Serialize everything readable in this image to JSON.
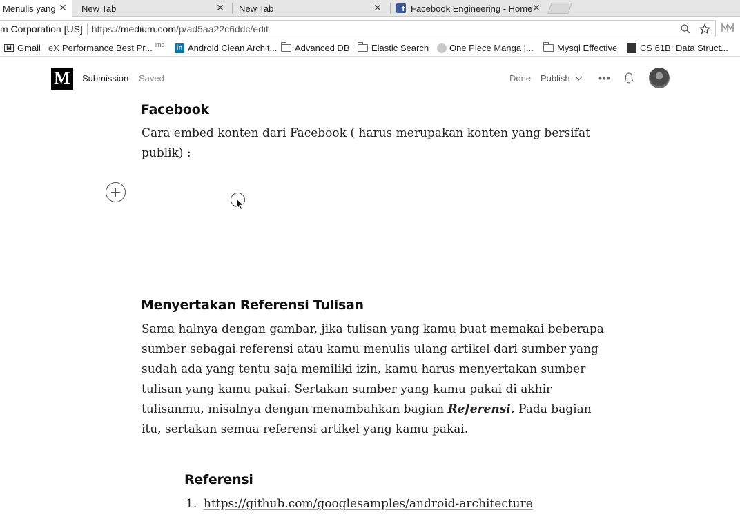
{
  "browser": {
    "tabs": [
      {
        "label": "Menulis yang"
      },
      {
        "label": "New Tab"
      },
      {
        "label": "New Tab"
      },
      {
        "label": "Facebook Engineering - Home"
      }
    ],
    "close_glyph": "✕",
    "address": {
      "org": "m Corporation [US]",
      "url_prefix": "https://",
      "url_host": "medium.com",
      "url_path": "/p/ad5aa22c6ddc/edit"
    },
    "bookmarks": [
      {
        "label": "Gmail",
        "icon": "gmail-icon"
      },
      {
        "label": "Performance Best Pr...",
        "icon": "ex-icon",
        "icon_text": "eX"
      },
      {
        "label": "",
        "icon": "imgur-icon",
        "icon_text": "img"
      },
      {
        "label": "Android Clean Archit...",
        "icon": "linkedin-icon",
        "icon_text": "in"
      },
      {
        "label": "Advanced DB",
        "icon": "folder-icon"
      },
      {
        "label": "Elastic Search",
        "icon": "folder-icon"
      },
      {
        "label": "One Piece Manga |...",
        "icon": "manga-icon"
      },
      {
        "label": "Mysql Effective",
        "icon": "folder-icon"
      },
      {
        "label": "CS 61B: Data Struct...",
        "icon": "cs61b-icon"
      }
    ]
  },
  "medium": {
    "logo": "M",
    "section": "Submission",
    "status": "Saved",
    "done_label": "Done",
    "publish_label": "Publish",
    "more_glyph": "•••"
  },
  "article": {
    "fb_heading": "Facebook",
    "fb_line1": "Cara embed konten dari Facebook ( harus merupakan konten yang bersifat",
    "fb_line2": "publik) :",
    "ref_heading": "Menyertakan Referensi Tulisan",
    "ref_lines": [
      "Sama halnya dengan gambar, jika tulisan yang kamu buat memakai beberapa",
      "sumber sebagai referensi atau kamu menulis ulang artikel dari sumber yang",
      "sudah ada yang tentu saja memiliki izin, kamu harus menyertakan sumber",
      "tulisan yang kamu pakai. Sertakan sumber yang kamu pakai di akhir"
    ],
    "ref_line5_pre": "tulisanmu, misalnya dengan menambahkan bagian ",
    "ref_line5_em": "Referensi.",
    "ref_line5_post": " Pada bagian",
    "ref_line6": "itu, sertakan semua referensi artikel yang kamu pakai.",
    "referensi_heading": "Referensi",
    "list": [
      {
        "num": "1.",
        "url": "https://github.com/googlesamples/android-architecture"
      }
    ]
  }
}
